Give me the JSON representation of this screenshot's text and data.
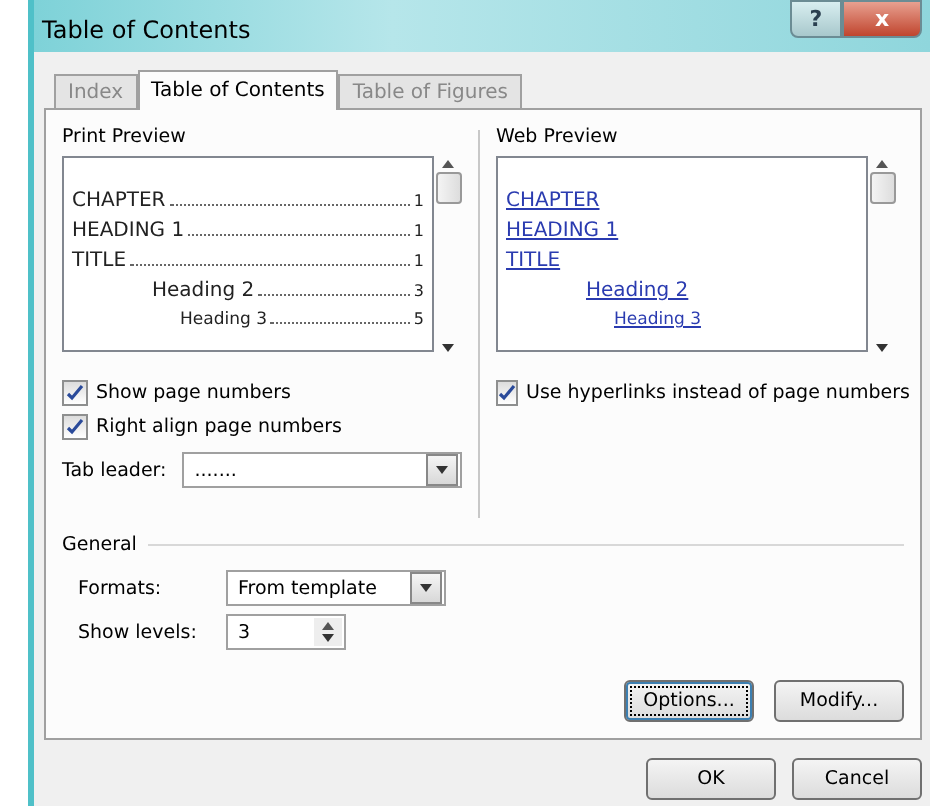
{
  "window": {
    "title": "Table of Contents",
    "help_button": "?",
    "close_button": "x"
  },
  "tabs": [
    {
      "label": "Index",
      "selected": false
    },
    {
      "label": "Table of Contents",
      "selected": true
    },
    {
      "label": "Table of Figures",
      "selected": false
    }
  ],
  "print_preview": {
    "label": "Print Preview",
    "entries": [
      {
        "text": "CHAPTER",
        "page": "1",
        "kind": "top"
      },
      {
        "text": "HEADING 1",
        "page": "1",
        "kind": "top"
      },
      {
        "text": "TITLE",
        "page": "1",
        "kind": "top"
      },
      {
        "text": "Heading 2",
        "page": "3",
        "kind": "level2"
      },
      {
        "text": "Heading 3",
        "page": "5",
        "kind": "level3"
      }
    ]
  },
  "web_preview": {
    "label": "Web Preview",
    "entries": [
      {
        "text": "CHAPTER",
        "kind": "top"
      },
      {
        "text": "HEADING 1",
        "kind": "top"
      },
      {
        "text": "TITLE",
        "kind": "top"
      },
      {
        "text": "Heading 2",
        "kind": "level2"
      },
      {
        "text": "Heading 3",
        "kind": "level3"
      }
    ]
  },
  "print_options": [
    {
      "label": "Show page numbers",
      "checked": true
    },
    {
      "label": "Right align page numbers",
      "checked": true
    }
  ],
  "tab_leader": {
    "label": "Tab leader:",
    "value": "......."
  },
  "web_options": [
    {
      "label": "Use hyperlinks instead of page numbers",
      "checked": true
    }
  ],
  "general": {
    "label": "General",
    "formats": {
      "label": "Formats:",
      "value": "From template"
    },
    "show_levels": {
      "label": "Show levels:",
      "value": "3"
    }
  },
  "panel_buttons": [
    {
      "label": "Options...",
      "focused": true
    },
    {
      "label": "Modify...",
      "focused": false
    }
  ],
  "dialog_buttons": [
    "OK",
    "Cancel"
  ]
}
